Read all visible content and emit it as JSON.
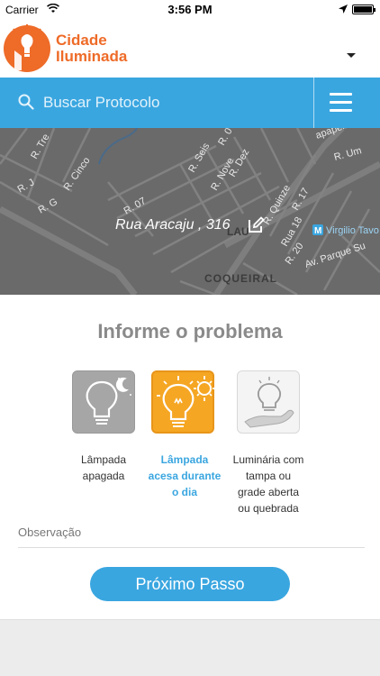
{
  "status_bar": {
    "carrier": "Carrier",
    "time": "3:56 PM",
    "battery_level": 1.0
  },
  "header": {
    "logo_line1": "Cidade",
    "logo_line2": "Iluminada",
    "brand_color": "#ee6b28",
    "dropdown_icon": "chevron-down-icon"
  },
  "search": {
    "placeholder": "Buscar Protocolo",
    "icon": "search-icon",
    "menu_icon": "hamburger-menu-icon",
    "bar_color": "#3aa6e0"
  },
  "map": {
    "address": "Rua Aracaju , 316",
    "edit_icon": "pencil-edit-icon",
    "labels": {
      "r_tres": "R. Tre",
      "r_cinco": "R. Cinco",
      "r_j": "R. J",
      "r_g": "R. G",
      "r_07": "R. 07",
      "r_seis": "R. Seis",
      "r_0": "R. 0",
      "r_nove": "R. Nove",
      "r_dez": "R. Dez",
      "r_um": "R. Um",
      "papeiro": "apapeiro",
      "r_quinze": "R. Quinze",
      "r_17": "R. 17",
      "rua_18": "Rua 18",
      "r_20": "R. 20",
      "av_parque": "Av. Parque Su",
      "virgilio": "Virgilio Tavo",
      "coqueiral": "COQUEIRAL",
      "lau": "LAU",
      "metro": "M"
    }
  },
  "problem": {
    "title": "Informe o problema",
    "options": [
      {
        "label_lines": [
          "Lâmpada",
          "apagada"
        ],
        "icon": "lamp-off-moon-icon",
        "selected": false
      },
      {
        "label_lines": [
          "Lâmpada",
          "acesa durante",
          "o dia"
        ],
        "icon": "lamp-on-sun-icon",
        "selected": true
      },
      {
        "label_lines": [
          "Luminária com",
          "tampa ou",
          "grade aberta",
          "ou quebrada"
        ],
        "icon": "lamp-hand-icon",
        "selected": false
      }
    ],
    "selected_color": "#f5a623",
    "selected_label_color": "#3aa6e0"
  },
  "observation": {
    "placeholder": "Observação"
  },
  "next_button": {
    "label": "Próximo Passo"
  }
}
